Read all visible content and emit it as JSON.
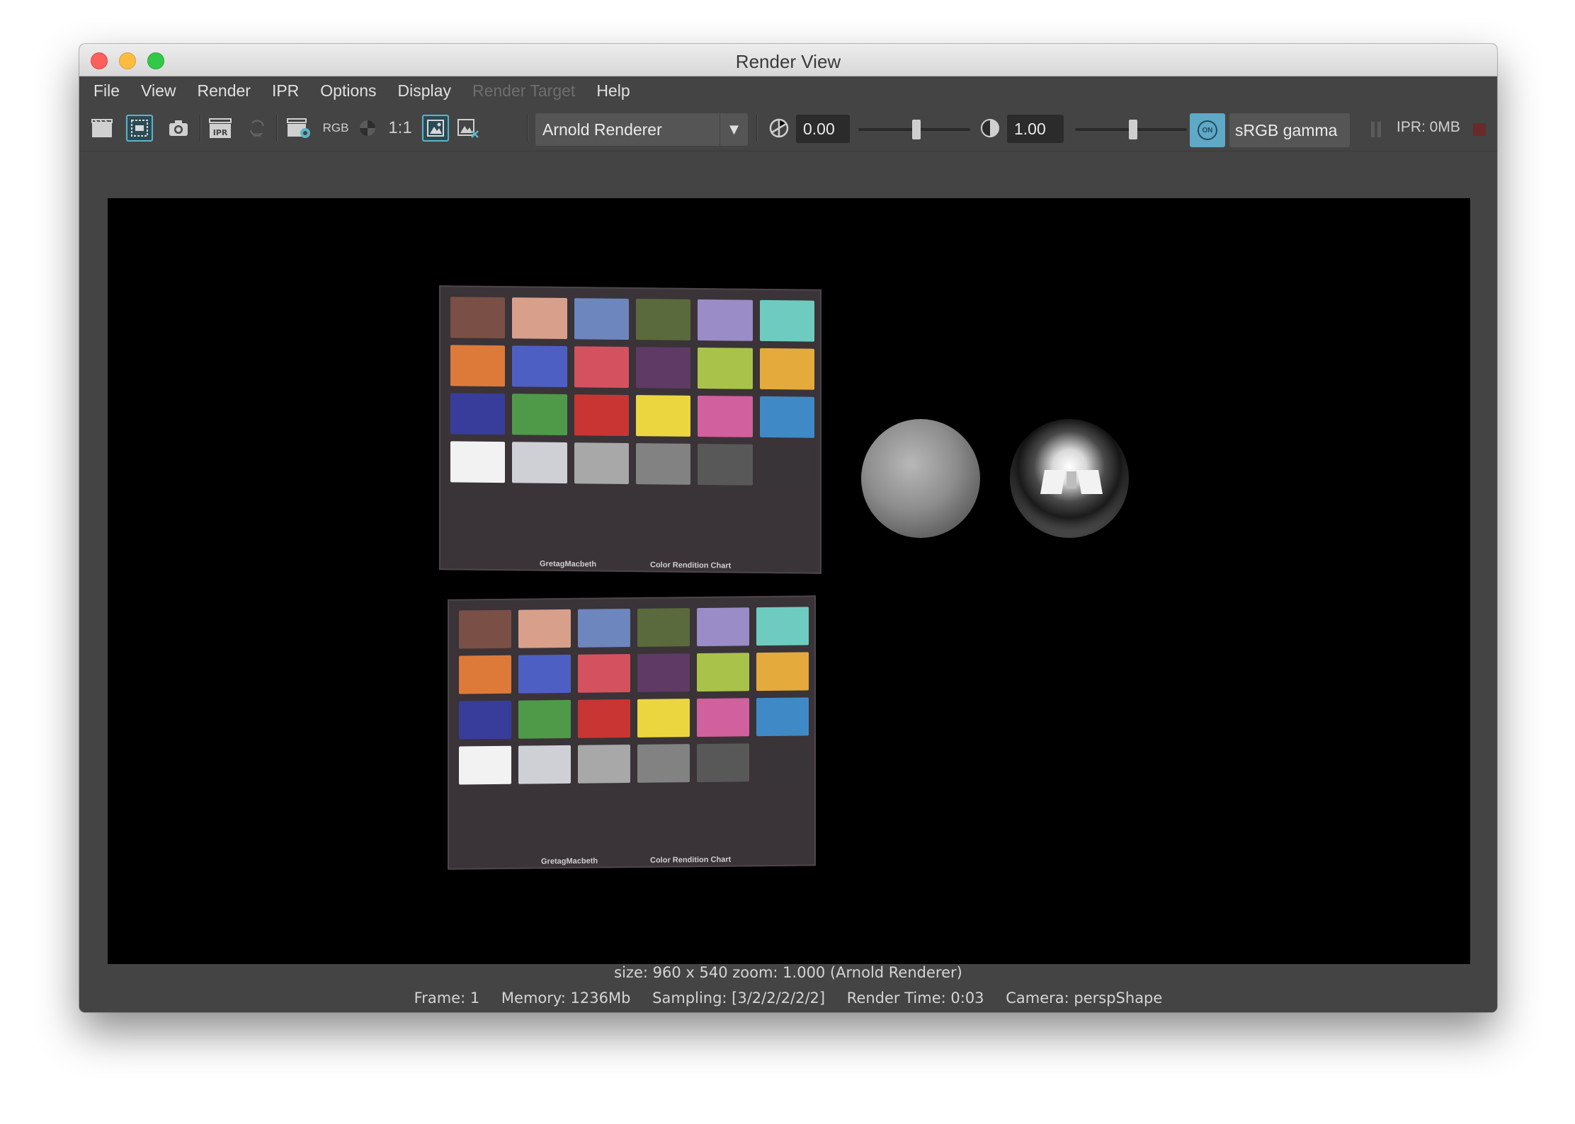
{
  "window": {
    "title": "Render View"
  },
  "menu": {
    "items": [
      "File",
      "View",
      "Render",
      "IPR",
      "Options",
      "Display",
      "Render Target",
      "Help"
    ]
  },
  "toolbar": {
    "icons": [
      "render-frame-icon",
      "render-region-icon",
      "snapshot-icon",
      "ipr-render-icon",
      "ipr-refresh-icon",
      "render-settings-icon",
      "rgb-channel-icon",
      "alpha-channel-icon",
      "real-size-icon",
      "keep-image-icon",
      "remove-image-icon",
      "exposure-icon",
      "gamma-icon",
      "color-management-toggle-icon"
    ],
    "rgb_label": "RGB",
    "real_size_label": "1:1",
    "renderer": "Arnold Renderer",
    "exposure": "0.00",
    "exposure_level": 0.52,
    "gamma": "1.00",
    "gamma_level": 0.52,
    "color_toggle_label": "ON",
    "color_space": "sRGB gamma",
    "ipr_memory": "IPR: 0MB"
  },
  "status": {
    "line1": "size: 960 x 540  zoom: 1.000     (Arnold Renderer)",
    "frame": "Frame: 1",
    "memory": "Memory: 1236Mb",
    "sampling": "Sampling: [3/2/2/2/2/2]",
    "render_time": "Render Time: 0:03",
    "camera": "Camera: perspShape"
  },
  "render": {
    "chart_labels": {
      "left": "GretagMacbeth",
      "right": "Color Rendition Chart"
    },
    "swatch_colors": [
      "#7a4f45",
      "#d8a08a",
      "#6d86bd",
      "#5a6a3c",
      "#9a8cc6",
      "#6ecbc0",
      "#dd7a3a",
      "#4e5fc4",
      "#d4525f",
      "#5e3a64",
      "#a9c34a",
      "#e4aa3c",
      "#383d9c",
      "#4f9a48",
      "#c93532",
      "#ecd640",
      "#d0609e",
      "#3f8ac6",
      "#f2f2f2",
      "#cfd0d6",
      "#a8a8a8",
      "#828282",
      "#585858",
      "#383438"
    ]
  }
}
